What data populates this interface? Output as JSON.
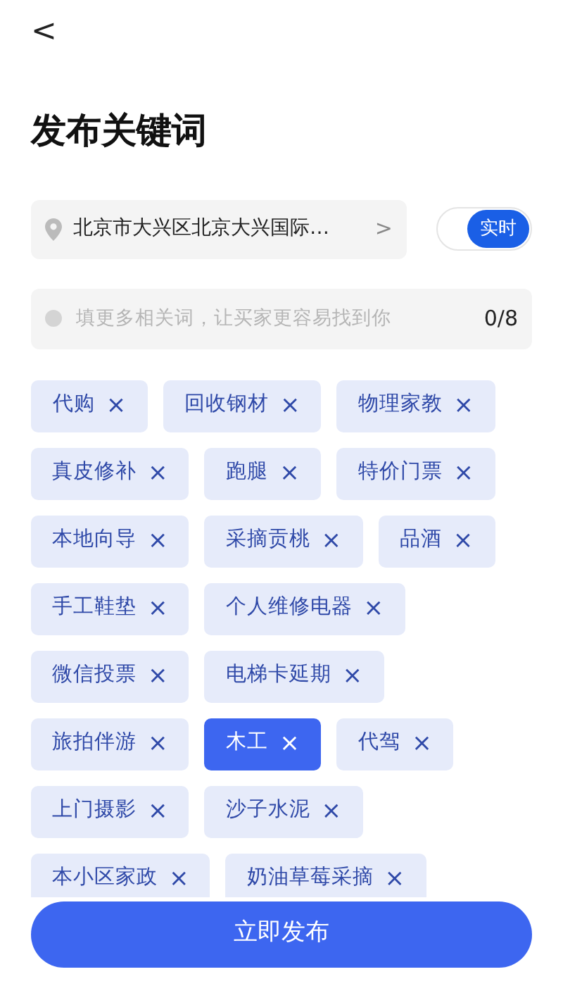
{
  "header": {
    "back": "<",
    "title": "发布关键词"
  },
  "location": {
    "value": "北京市大兴区北京大兴国际…",
    "chevron": ">"
  },
  "realtime_toggle": {
    "label": "实时",
    "on": true
  },
  "keyword_input": {
    "placeholder": "填更多相关词，让买家更容易找到你",
    "count": "0/8"
  },
  "tags": [
    {
      "label": "代购",
      "remove": "×",
      "selected": false
    },
    {
      "label": "回收钢材",
      "remove": "×",
      "selected": false
    },
    {
      "label": "物理家教",
      "remove": "×",
      "selected": false
    },
    {
      "label": "真皮修补",
      "remove": "×",
      "selected": false
    },
    {
      "label": "跑腿",
      "remove": "×",
      "selected": false
    },
    {
      "label": "特价门票",
      "remove": "×",
      "selected": false
    },
    {
      "label": "本地向导",
      "remove": "×",
      "selected": false
    },
    {
      "label": "采摘贡桃",
      "remove": "×",
      "selected": false
    },
    {
      "label": "品酒",
      "remove": "×",
      "selected": false
    },
    {
      "label": "手工鞋垫",
      "remove": "×",
      "selected": false
    },
    {
      "label": "个人维修电器",
      "remove": "×",
      "selected": false
    },
    {
      "label": "微信投票",
      "remove": "×",
      "selected": false
    },
    {
      "label": "电梯卡延期",
      "remove": "×",
      "selected": false
    },
    {
      "label": "旅拍伴游",
      "remove": "×",
      "selected": false
    },
    {
      "label": "木工",
      "remove": "×",
      "selected": true
    },
    {
      "label": "代驾",
      "remove": "×",
      "selected": false
    },
    {
      "label": "上门摄影",
      "remove": "×",
      "selected": false
    },
    {
      "label": "沙子水泥",
      "remove": "×",
      "selected": false
    },
    {
      "label": "本小区家政",
      "remove": "×",
      "selected": false
    },
    {
      "label": "奶油草莓采摘",
      "remove": "×",
      "selected": false
    }
  ],
  "publish_button": "立即发布"
}
